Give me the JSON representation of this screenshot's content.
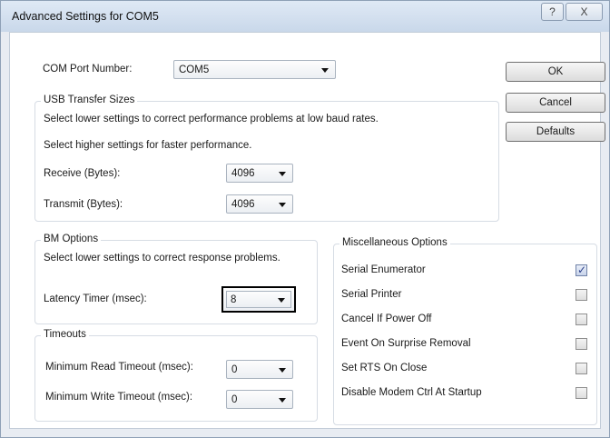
{
  "window": {
    "title": "Advanced Settings for COM5",
    "help_glyph": "?",
    "close_glyph": "X"
  },
  "com_port": {
    "label": "COM Port Number:",
    "value": "COM5"
  },
  "usb": {
    "title": "USB Transfer Sizes",
    "hint_low": "Select lower settings to correct performance problems at low baud rates.",
    "hint_high": "Select higher settings for faster performance.",
    "receive_label": "Receive (Bytes):",
    "receive_value": "4096",
    "transmit_label": "Transmit (Bytes):",
    "transmit_value": "4096"
  },
  "bm": {
    "title": "BM Options",
    "hint": "Select lower settings to correct response problems.",
    "latency_label": "Latency Timer (msec):",
    "latency_value": "8"
  },
  "timeouts": {
    "title": "Timeouts",
    "read_label": "Minimum Read Timeout (msec):",
    "read_value": "0",
    "write_label": "Minimum Write Timeout (msec):",
    "write_value": "0"
  },
  "misc": {
    "title": "Miscellaneous Options",
    "options": [
      {
        "label": "Serial Enumerator",
        "checked": true
      },
      {
        "label": "Serial Printer",
        "checked": false
      },
      {
        "label": "Cancel If Power Off",
        "checked": false
      },
      {
        "label": "Event On Surprise Removal",
        "checked": false
      },
      {
        "label": "Set RTS On Close",
        "checked": false
      },
      {
        "label": "Disable Modem Ctrl At Startup",
        "checked": false
      }
    ]
  },
  "buttons": {
    "ok": "OK",
    "cancel": "Cancel",
    "defaults": "Defaults"
  }
}
